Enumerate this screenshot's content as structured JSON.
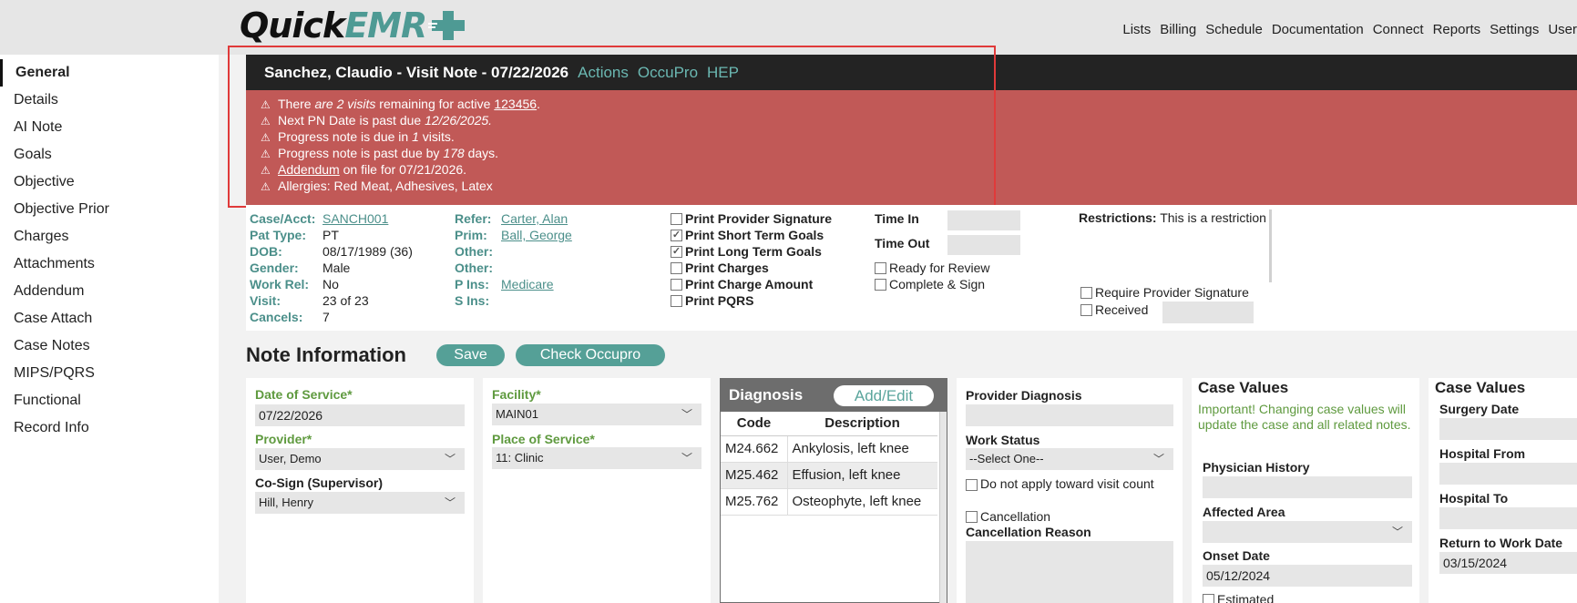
{
  "brand": {
    "part1": "Quick",
    "part2": "EMR",
    "plus_symbol": "+"
  },
  "top_nav": [
    "Lists",
    "Billing",
    "Schedule",
    "Documentation",
    "Connect",
    "Reports",
    "Settings",
    "User"
  ],
  "side_nav": [
    "General",
    "Details",
    "AI Note",
    "Goals",
    "Objective",
    "Objective Prior",
    "Charges",
    "Attachments",
    "Addendum",
    "Case Attach",
    "Case Notes",
    "MIPS/PQRS",
    "Functional",
    "Record Info"
  ],
  "visit": {
    "title": "Sanchez, Claudio - Visit Note - 07/22/2026",
    "links": [
      "Actions",
      "OccuPro",
      "HEP"
    ]
  },
  "alerts": {
    "a1_pre": "There ",
    "a1_em": "are 2 visits",
    "a1_mid": " remaining for active ",
    "a1_link": "123456",
    "a1_post": ".",
    "a2_pre": "Next PN Date is past due ",
    "a2_em": "12/26/2025.",
    "a3_pre": "Progress note is due in ",
    "a3_em": "1",
    "a3_post": " visits.",
    "a4_pre": "Progress note is past due by ",
    "a4_em": "178",
    "a4_post": " days.",
    "a5_link": "Addendum",
    "a5_post": " on file for 07/21/2026.",
    "a6": "Allergies: Red Meat, Adhesives, Latex"
  },
  "patient": {
    "case_acct_label": "Case/Acct:",
    "case_acct": "SANCH001",
    "pat_type_label": "Pat Type:",
    "pat_type": "PT",
    "dob_label": "DOB:",
    "dob": "08/17/1989 (36)",
    "gender_label": "Gender:",
    "gender": "Male",
    "work_rel_label": "Work Rel:",
    "work_rel": "No",
    "visit_label": "Visit:",
    "visit": "23 of 23",
    "cancels_label": "Cancels:",
    "cancels": "7",
    "refer_label": "Refer:",
    "refer": "Carter, Alan",
    "prim_label": "Prim:",
    "prim": "Ball, George",
    "other1_label": "Other:",
    "other2_label": "Other:",
    "p_ins_label": "P Ins:",
    "p_ins": "Medicare",
    "s_ins_label": "S Ins:"
  },
  "print_options": [
    {
      "label": "Print Provider Signature",
      "checked": false
    },
    {
      "label": "Print Short Term Goals",
      "checked": true
    },
    {
      "label": "Print Long Term Goals",
      "checked": true
    },
    {
      "label": "Print Charges",
      "checked": false
    },
    {
      "label": "Print Charge Amount",
      "checked": false
    },
    {
      "label": "Print PQRS",
      "checked": false
    }
  ],
  "time": {
    "in_label": "Time In",
    "out_label": "Time Out"
  },
  "status_checks": {
    "ready": "Ready for Review",
    "complete": "Complete & Sign"
  },
  "restrictions": {
    "label": "Restrictions:",
    "text": " This is a restriction"
  },
  "provider_checks": {
    "require_sig": "Require Provider Signature",
    "received": "Received"
  },
  "note_info": {
    "title": "Note Information",
    "save": "Save",
    "check_occupro": "Check Occupro"
  },
  "service": {
    "dos_label": "Date of Service*",
    "dos": "07/22/2026",
    "provider_label": "Provider*",
    "provider": "User, Demo",
    "cosign_label": "Co-Sign (Supervisor)",
    "cosign": "Hill, Henry"
  },
  "facility": {
    "facility_label": "Facility*",
    "facility": "MAIN01",
    "pos_label": "Place of Service*",
    "pos": "11: Clinic"
  },
  "diagnosis": {
    "title": "Diagnosis",
    "add_edit": "Add/Edit",
    "col_code": "Code",
    "col_desc": "Description",
    "rows": [
      {
        "code": "M24.662",
        "desc": "Ankylosis, left knee"
      },
      {
        "code": "M25.462",
        "desc": "Effusion, left knee"
      },
      {
        "code": "M25.762",
        "desc": "Osteophyte, left knee"
      }
    ]
  },
  "provider_dx": {
    "label": "Provider Diagnosis",
    "work_status_label": "Work Status",
    "work_status": "--Select One--",
    "no_apply": "Do not apply toward visit count",
    "cancellation": "Cancellation",
    "cancel_reason_label": "Cancellation Reason"
  },
  "case_values1": {
    "title": "Case Values",
    "warning": "Important! Changing case values will update the case and all related notes.",
    "physician_history": "Physician History",
    "affected_area": "Affected Area",
    "onset_label": "Onset Date",
    "onset": "05/12/2024",
    "estimated": "Estimated"
  },
  "case_values2": {
    "title": "Case Values",
    "surgery": "Surgery Date",
    "hosp_from": "Hospital From",
    "hosp_to": "Hospital To",
    "rtw_label": "Return to Work Date",
    "rtw": "03/15/2024"
  }
}
